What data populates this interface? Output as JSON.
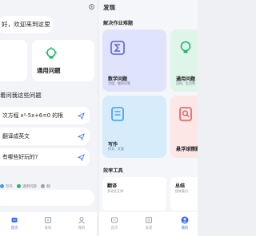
{
  "left": {
    "greeting": "好，欢迎来到这里",
    "cards": [
      {
        "label": "通用问题",
        "icon": "lightbulb-icon",
        "color": "#1fb86b"
      }
    ],
    "ask_title": "着问我这些问题",
    "questions": [
      "次方程 x²-5x+6=0 的根",
      "翻译成英文",
      "有哪些好玩的?"
    ],
    "chips": [
      {
        "label": "写作",
        "color": "#3b9bf5"
      },
      {
        "label": "通用问题",
        "color": "#1fb86b"
      },
      {
        "label": "翻",
        "color": "#9aa0ab"
      }
    ],
    "nav": [
      {
        "label": "首页",
        "icon": "home-icon",
        "active": true
      },
      {
        "label": "发现",
        "icon": "discover-icon",
        "active": false
      },
      {
        "label": "我的",
        "icon": "profile-icon",
        "active": false
      }
    ]
  },
  "right": {
    "title": "发现",
    "section_title": "解决作业难题",
    "tiles": [
      {
        "title": "数学问题",
        "subtitle": "方程、微积分等",
        "icon": "sigma-icon",
        "color": "#5b63d8"
      },
      {
        "title": "通用问题",
        "subtitle": "百科、生活等",
        "icon": "lightbulb-icon",
        "color": "#1fb86b"
      },
      {
        "title": "写作",
        "subtitle": "作文、文案",
        "icon": "document-icon",
        "color": "#3b9bf5"
      },
      {
        "title": "悬浮球猜题",
        "subtitle": "",
        "icon": "search-doc-icon",
        "color": "#e05a5a"
      }
    ],
    "tools_title": "效率工具",
    "tools": [
      {
        "title": "翻译",
        "subtitle": "多语言互译"
      },
      {
        "title": "总结",
        "subtitle": "提炼要点"
      }
    ],
    "nav": [
      {
        "label": "首页",
        "icon": "home-icon",
        "active": false
      },
      {
        "label": "发现",
        "icon": "discover-icon",
        "active": false
      },
      {
        "label": "我的",
        "icon": "profile-icon",
        "active": true
      }
    ]
  }
}
